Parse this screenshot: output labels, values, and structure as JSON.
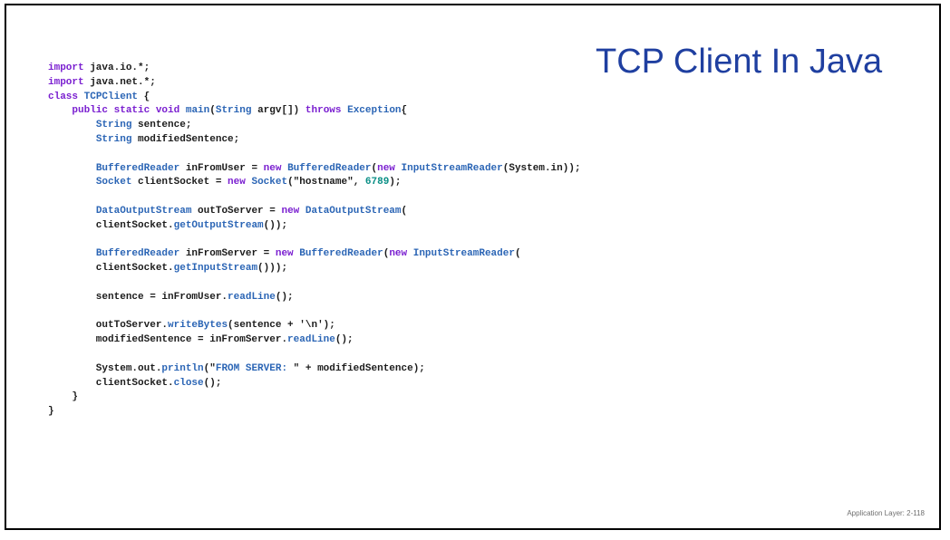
{
  "slide": {
    "title": "TCP Client In Java",
    "footer": "Application Layer: 2-118",
    "colors": {
      "title": "#1f3fa0",
      "keyword": "#7a1fd0",
      "type": "#2b65b5",
      "number": "#0a8f86",
      "plain": "#1c1c1c",
      "border": "#000000"
    }
  },
  "code": {
    "lines": [
      [
        [
          "keyword",
          "import"
        ],
        [
          "plain",
          " java.io.*;"
        ]
      ],
      [
        [
          "keyword",
          "import"
        ],
        [
          "plain",
          " java.net.*;"
        ]
      ],
      [
        [
          "keyword",
          "class"
        ],
        [
          "plain",
          " "
        ],
        [
          "type",
          "TCPClient"
        ],
        [
          "plain",
          " {"
        ]
      ],
      [
        [
          "plain",
          "    "
        ],
        [
          "keyword",
          "public static void"
        ],
        [
          "plain",
          " "
        ],
        [
          "type",
          "main"
        ],
        [
          "plain",
          "("
        ],
        [
          "type",
          "String"
        ],
        [
          "plain",
          " argv[]) "
        ],
        [
          "keyword",
          "throws"
        ],
        [
          "plain",
          " "
        ],
        [
          "type",
          "Exception"
        ],
        [
          "plain",
          "{"
        ]
      ],
      [
        [
          "plain",
          "        "
        ],
        [
          "type",
          "String"
        ],
        [
          "plain",
          " sentence;"
        ]
      ],
      [
        [
          "plain",
          "        "
        ],
        [
          "type",
          "String"
        ],
        [
          "plain",
          " modifiedSentence;"
        ]
      ],
      [],
      [
        [
          "plain",
          "        "
        ],
        [
          "type",
          "BufferedReader"
        ],
        [
          "plain",
          " inFromUser = "
        ],
        [
          "keyword",
          "new"
        ],
        [
          "plain",
          " "
        ],
        [
          "type",
          "BufferedReader"
        ],
        [
          "plain",
          "("
        ],
        [
          "keyword",
          "new"
        ],
        [
          "plain",
          " "
        ],
        [
          "type",
          "InputStreamReader"
        ],
        [
          "plain",
          "(System.in));"
        ]
      ],
      [
        [
          "plain",
          "        "
        ],
        [
          "type",
          "Socket"
        ],
        [
          "plain",
          " clientSocket = "
        ],
        [
          "keyword",
          "new"
        ],
        [
          "plain",
          " "
        ],
        [
          "type",
          "Socket"
        ],
        [
          "plain",
          "(\"hostname\", "
        ],
        [
          "number",
          "6789"
        ],
        [
          "plain",
          ");"
        ]
      ],
      [],
      [
        [
          "plain",
          "        "
        ],
        [
          "type",
          "DataOutputStream"
        ],
        [
          "plain",
          " outToServer = "
        ],
        [
          "keyword",
          "new"
        ],
        [
          "plain",
          " "
        ],
        [
          "type",
          "DataOutputStream"
        ],
        [
          "plain",
          "("
        ]
      ],
      [
        [
          "plain",
          "        clientSocket."
        ],
        [
          "type",
          "getOutputStream"
        ],
        [
          "plain",
          "());"
        ]
      ],
      [],
      [
        [
          "plain",
          "        "
        ],
        [
          "type",
          "BufferedReader"
        ],
        [
          "plain",
          " inFromServer = "
        ],
        [
          "keyword",
          "new"
        ],
        [
          "plain",
          " "
        ],
        [
          "type",
          "BufferedReader"
        ],
        [
          "plain",
          "("
        ],
        [
          "keyword",
          "new"
        ],
        [
          "plain",
          " "
        ],
        [
          "type",
          "InputStreamReader"
        ],
        [
          "plain",
          "("
        ]
      ],
      [
        [
          "plain",
          "        clientSocket."
        ],
        [
          "type",
          "getInputStream"
        ],
        [
          "plain",
          "()));"
        ]
      ],
      [],
      [
        [
          "plain",
          "        sentence = inFromUser."
        ],
        [
          "type",
          "readLine"
        ],
        [
          "plain",
          "();"
        ]
      ],
      [],
      [
        [
          "plain",
          "        outToServer."
        ],
        [
          "type",
          "writeBytes"
        ],
        [
          "plain",
          "(sentence + '\\n');"
        ]
      ],
      [
        [
          "plain",
          "        modifiedSentence = inFromServer."
        ],
        [
          "type",
          "readLine"
        ],
        [
          "plain",
          "();"
        ]
      ],
      [],
      [
        [
          "plain",
          "        System.out."
        ],
        [
          "type",
          "println"
        ],
        [
          "plain",
          "(\""
        ],
        [
          "string",
          "FROM SERVER: "
        ],
        [
          "plain",
          "\" + modifiedSentence);"
        ]
      ],
      [
        [
          "plain",
          "        clientSocket."
        ],
        [
          "type",
          "close"
        ],
        [
          "plain",
          "();"
        ]
      ],
      [
        [
          "plain",
          "    }"
        ]
      ],
      [
        [
          "plain",
          "}"
        ]
      ]
    ]
  }
}
